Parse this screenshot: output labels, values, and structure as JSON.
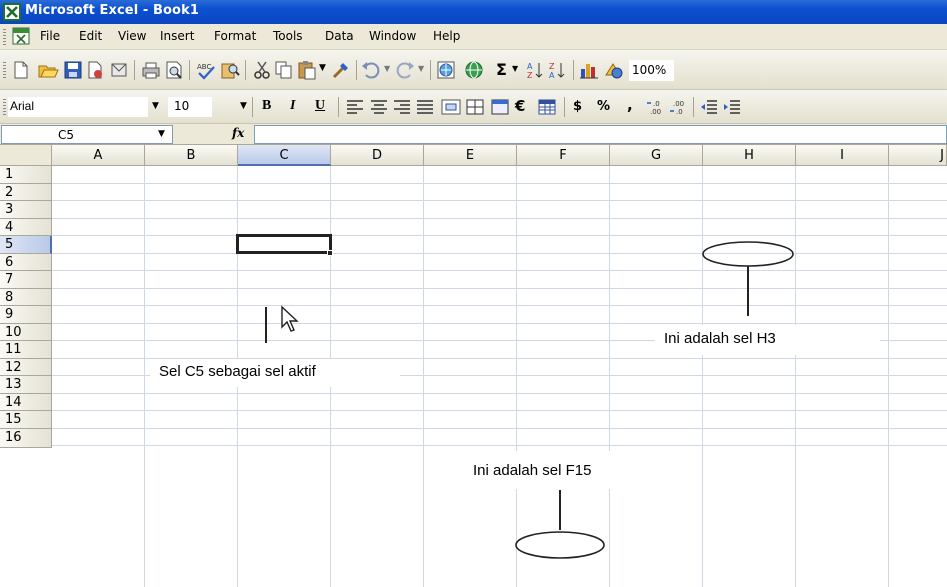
{
  "window": {
    "title": "Microsoft Excel - Book1"
  },
  "menu": [
    "File",
    "Edit",
    "View",
    "Insert",
    "Format",
    "Tools",
    "Data",
    "Window",
    "Help"
  ],
  "standard_toolbar": {
    "zoom": "100%",
    "icons": [
      "new-icon",
      "open-icon",
      "save-icon",
      "permission-icon",
      "print-icon",
      "print-preview-icon",
      "spelling-icon",
      "research-icon",
      "cut-icon",
      "copy-icon",
      "paste-icon",
      "format-painter-icon",
      "undo-icon",
      "redo-icon",
      "insert-hyperlink-icon",
      "autosum-icon",
      "sort-ascending-icon",
      "sort-descending-icon",
      "chart-wizard-icon",
      "drawing-icon"
    ]
  },
  "formatting_toolbar": {
    "font": "Arial",
    "size": "10",
    "bold": "B",
    "italic": "I",
    "underline": "U",
    "currency": "$",
    "percent": "%",
    "comma": ",",
    "euro": "€"
  },
  "formula_bar": {
    "name_box": "C5",
    "fx": "fx",
    "value": ""
  },
  "sheet": {
    "columns": [
      "A",
      "B",
      "C",
      "D",
      "E",
      "F",
      "G",
      "H",
      "I",
      "J"
    ],
    "rows": [
      "1",
      "2",
      "3",
      "4",
      "5",
      "6",
      "7",
      "8",
      "9",
      "10",
      "11",
      "12",
      "13",
      "14",
      "15",
      "16"
    ],
    "active_cell": "C5"
  },
  "annotations": {
    "active_cell": "Sel C5 sebagai sel aktif",
    "h3": "Ini adalah sel H3",
    "f15": "Ini adalah sel F15"
  }
}
